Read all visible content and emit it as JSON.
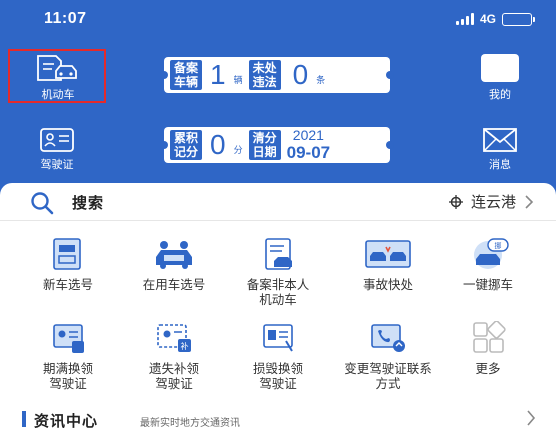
{
  "status_bar": {
    "time": "11:07",
    "network": "4G"
  },
  "header": {
    "vehicle": {
      "label": "机动车",
      "icon": "car-document-icon",
      "highlight_color": "#e52a2a"
    },
    "mine": {
      "label": "我的",
      "icon": "profile-icon"
    },
    "license": {
      "label": "驾驶证",
      "icon": "id-card-icon"
    },
    "messages": {
      "label": "消息",
      "icon": "envelope-icon"
    },
    "card_registration": {
      "tile1_line1": "备案",
      "tile1_line2": "车辆",
      "count": "1",
      "count_unit": "辆",
      "tile2_line1": "未处",
      "tile2_line2": "违法",
      "violations": "0",
      "violations_unit": "条"
    },
    "card_points": {
      "tile1_line1": "累积",
      "tile1_line2": "记分",
      "points": "0",
      "points_unit": "分",
      "tile2_line1": "清分",
      "tile2_line2": "日期",
      "year": "2021",
      "month_day": "09-07"
    }
  },
  "search": {
    "label": "搜索",
    "city": "连云港"
  },
  "services": [
    {
      "label": "新车选号",
      "icon": "new-car-plate-icon"
    },
    {
      "label": "在用车选号",
      "icon": "used-car-plate-icon"
    },
    {
      "label": "备案非本人机动车",
      "icon": "register-vehicle-icon"
    },
    {
      "label": "事故快处",
      "icon": "accident-icon"
    },
    {
      "label": "一键挪车",
      "icon": "move-car-icon"
    },
    {
      "label": "期满换领驾驶证",
      "icon": "license-renew-icon"
    },
    {
      "label": "遗失补领驾驶证",
      "icon": "license-lost-icon"
    },
    {
      "label": "损毁换领驾驶证",
      "icon": "license-damaged-icon"
    },
    {
      "label": "变更驾驶证联系方式",
      "icon": "license-contact-icon"
    },
    {
      "label": "更多",
      "icon": "more-grid-icon"
    }
  ],
  "news": {
    "title": "资讯中心",
    "subtitle": "最新实时地方交通资讯"
  },
  "colors": {
    "primary": "#2f66c6",
    "light_icon_blue": "#cfe0f7"
  }
}
